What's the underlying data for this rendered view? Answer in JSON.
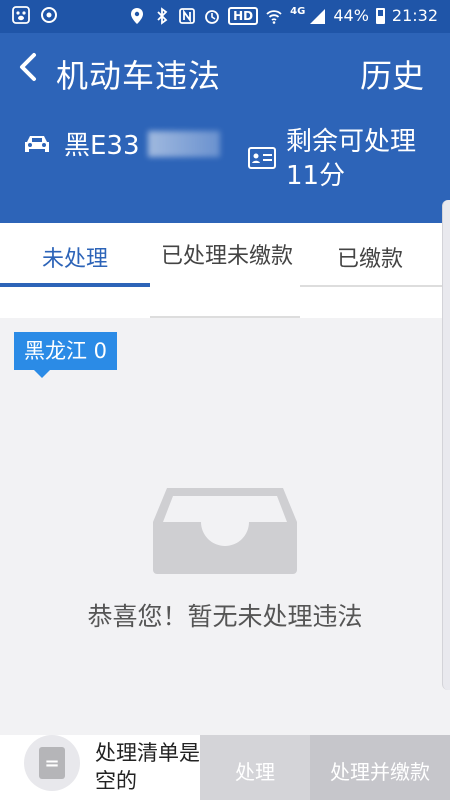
{
  "status_bar": {
    "battery": "44%",
    "time": "21:32",
    "hd": "HD",
    "network": "4G"
  },
  "header": {
    "title": "机动车违法",
    "history_label": "历史",
    "plate_visible": "黑E33",
    "points_text": "剩余可处理11分"
  },
  "tabs": [
    {
      "label": "未处理",
      "active": true
    },
    {
      "label": "已处理未缴款",
      "active": false
    },
    {
      "label": "已缴款",
      "active": false
    }
  ],
  "region_badge": "黑龙江 0",
  "empty_message": "恭喜您！暂无未处理违法",
  "bottom_bar": {
    "list_icon_glyph": "=",
    "list_text": "处理清单是空的",
    "process_label": "处理",
    "process_pay_label": "处理并缴款"
  },
  "colors": {
    "header_bg": "#2d64b8",
    "status_bg": "#1f55a8",
    "accent": "#2d64b8",
    "badge_bg": "#2b8be6"
  }
}
